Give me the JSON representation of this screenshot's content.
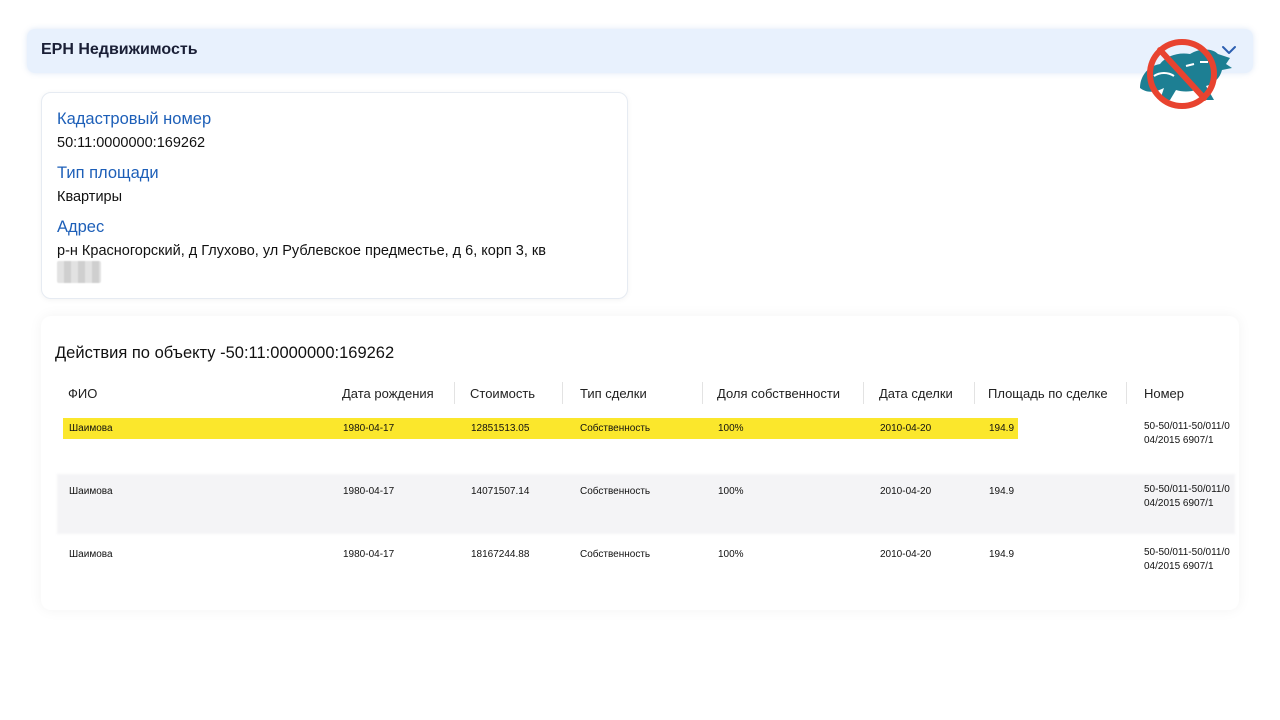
{
  "header": {
    "title": "ЕРН Недвижимость"
  },
  "info": {
    "cadastral_label": "Кадастровый номер",
    "cadastral_value": "50:11:0000000:169262",
    "area_type_label": "Тип площади",
    "area_type_value": "Квартиры",
    "address_label": "Адрес",
    "address_value": "р-н Красногорский, д Глухово, ул Рублевское предместье, д 6, корп 3, кв"
  },
  "actions": {
    "title": "Действия по объекту -50:11:0000000:169262",
    "columns": [
      "ФИО",
      "Дата рождения",
      "Стоимость",
      "Тип сделки",
      "Доля собственности",
      "Дата сделки",
      "Площадь по сделке",
      "Номер"
    ],
    "rows": [
      {
        "fio": "Шаимова",
        "birth": "1980-04-17",
        "cost": "12851513.05",
        "type": "Собственность",
        "share": "100%",
        "deal_date": "2010-04-20",
        "area": "194.9",
        "number": "50-50/011-50/011/004/2015 6907/1",
        "highlighted": true
      },
      {
        "fio": "Шаимова",
        "birth": "1980-04-17",
        "cost": "14071507.14",
        "type": "Собственность",
        "share": "100%",
        "deal_date": "2010-04-20",
        "area": "194.9",
        "number": "50-50/011-50/011/004/2015 6907/1",
        "highlighted": false
      },
      {
        "fio": "Шаимова",
        "birth": "1980-04-17",
        "cost": "18167244.88",
        "type": "Собственность",
        "share": "100%",
        "deal_date": "2010-04-20",
        "area": "194.9",
        "number": "50-50/011-50/011/004/2015 6907/1",
        "highlighted": false
      }
    ]
  },
  "colors": {
    "header_bg": "#e8f1fd",
    "label_blue": "#1d5fb8",
    "highlight_yellow": "#fbe72c",
    "logo_red": "#e8432f",
    "logo_teal": "#1d7f93"
  },
  "icons": {
    "header_toggle": "chevron-down-icon",
    "logo": "crossed-bear-logo"
  }
}
